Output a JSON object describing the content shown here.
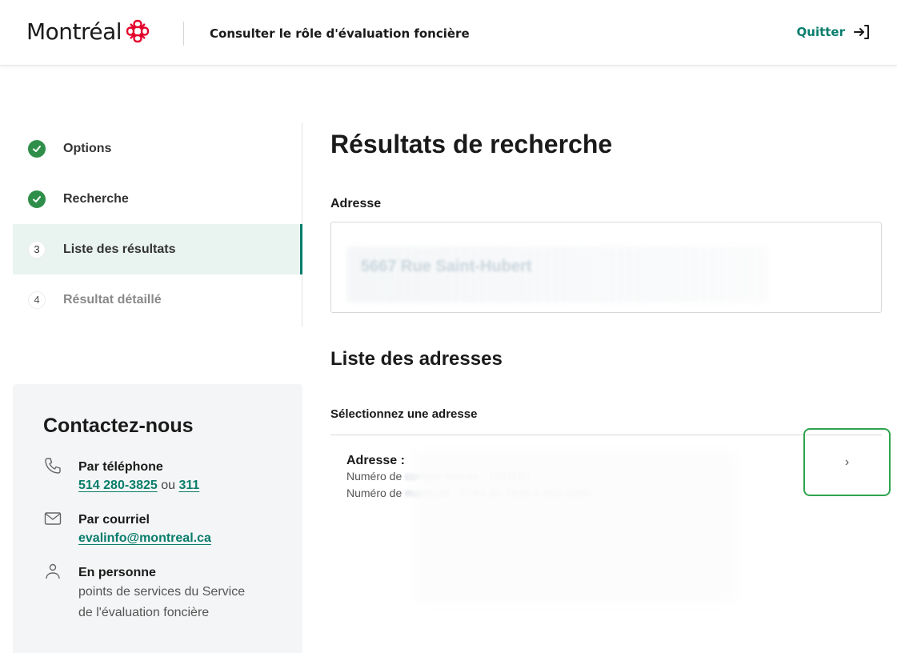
{
  "header": {
    "logo_text": "Montréal",
    "title": "Consulter le rôle d'évaluation foncière",
    "quit_label": "Quitter",
    "brand_color": "#e4002b",
    "accent_color": "#097d6c"
  },
  "stepper": {
    "steps": [
      {
        "number": "1",
        "label": "Options",
        "state": "done"
      },
      {
        "number": "2",
        "label": "Recherche",
        "state": "done"
      },
      {
        "number": "3",
        "label": "Liste des résultats",
        "state": "active"
      },
      {
        "number": "4",
        "label": "Résultat détaillé",
        "state": "disabled"
      }
    ]
  },
  "contact": {
    "title": "Contactez-nous",
    "phone": {
      "title": "Par téléphone",
      "number": "514 280-3825",
      "or": "ou",
      "short": "311"
    },
    "email": {
      "title": "Par courriel",
      "address": "evalinfo@montreal.ca"
    },
    "person": {
      "title": "En personne",
      "line1": "points de services du Service",
      "line2": "de l'évaluation foncière"
    }
  },
  "main": {
    "title": "Résultats de recherche",
    "address_label": "Adresse",
    "address_value": "5667 Rue Saint-Hubert",
    "list_title": "Liste des adresses",
    "select_label": "Sélectionnez une adresse",
    "results": [
      {
        "title": "Adresse :",
        "line1_label": "Numéro de",
        "line1_value": "compte foncier : 1011180",
        "line2_label": "Numéro de",
        "line2_value": "matricule : 9743-36-7848-5-000-0000",
        "arrow": "›"
      }
    ]
  }
}
